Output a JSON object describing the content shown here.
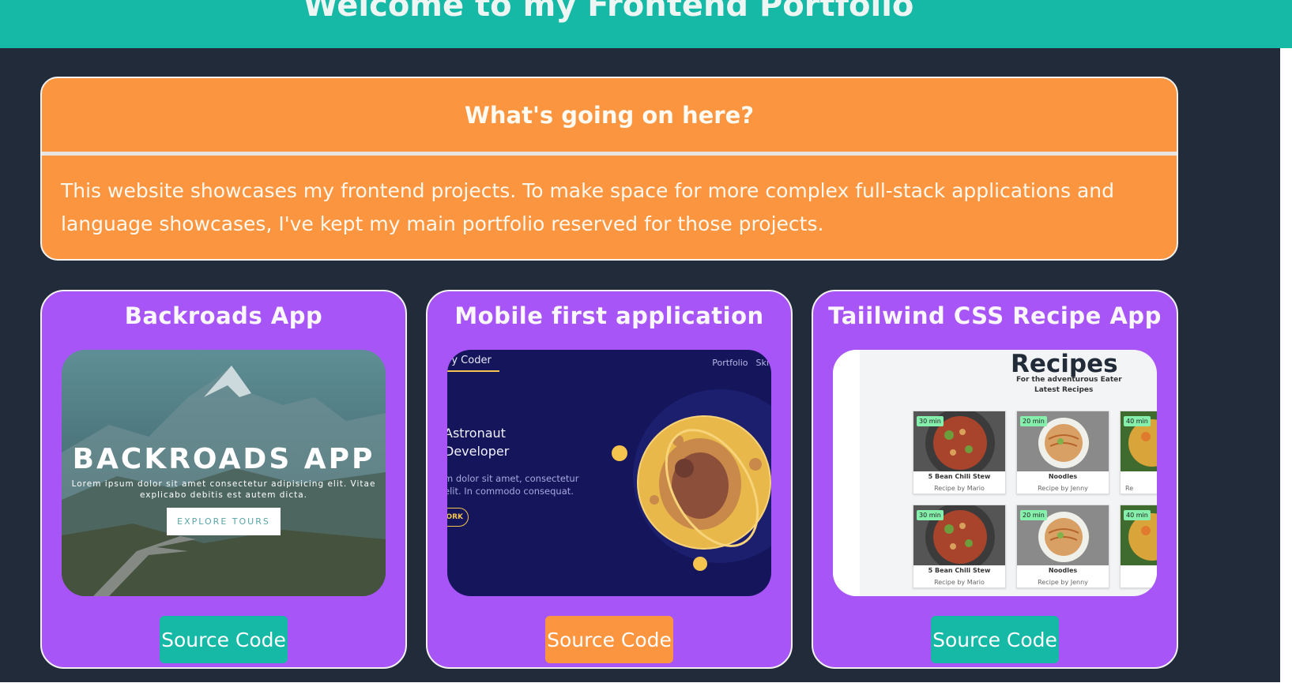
{
  "header": {
    "title": "Welcome to my Frontend Portfolio"
  },
  "info": {
    "heading": "What's going on here?",
    "body": "This website showcases my frontend projects. To make space for more complex full-stack applications and language showcases, I've kept my main portfolio reserved for those projects."
  },
  "projects": [
    {
      "title": "Backroads App",
      "button": "Source Code",
      "button_color": "#16b8a6",
      "preview": {
        "brand": "BACKROADS APP",
        "subtitle": "Lorem ipsum dolor sit amet consectetur adipisicing elit. Vitae explicabo debitis est autem dicta.",
        "cta": "EXPLORE TOURS"
      }
    },
    {
      "title": "Mobile first application",
      "button": "Source Code",
      "button_color": "#fb953f",
      "preview": {
        "logo": "ry Coder",
        "nav": [
          "Portfolio",
          "Skil"
        ],
        "heading_line1": "Astronaut",
        "heading_line2": " Developer",
        "para_line1": "m dolor sit amet, consectetur",
        "para_line2": "elit. In commodo consequat.",
        "cta": "ORK"
      }
    },
    {
      "title": "Taiilwind CSS Recipe App",
      "button": "Source Code",
      "button_color": "#16b8a6",
      "preview": {
        "title": "Recipes",
        "subtitle": "For the adventurous Eater",
        "latest": "Latest Recipes",
        "cards": [
          {
            "time": "30 min",
            "name": "5 Bean Chili Stew",
            "by": "Recipe by Mario"
          },
          {
            "time": "20 min",
            "name": "Noodles",
            "by": "Recipe by Jenny"
          },
          {
            "time": "40 min",
            "name": "",
            "by": "Re"
          },
          {
            "time": "30 min",
            "name": "5 Bean Chili Stew",
            "by": "Recipe by Mario"
          },
          {
            "time": "20 min",
            "name": "Noodles",
            "by": "Recipe by Jenny"
          },
          {
            "time": "40 min",
            "name": "",
            "by": ""
          }
        ]
      }
    }
  ],
  "colors": {
    "background": "#212b3a",
    "header": "#16b8a6",
    "info_panel": "#fb953f",
    "card": "#a855f7"
  }
}
